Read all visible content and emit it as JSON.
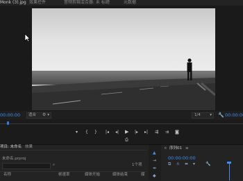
{
  "app": {
    "tabs": [
      {
        "label": "Monk (3).jpg",
        "active": true
      },
      {
        "label": "效果控件",
        "active": false
      },
      {
        "label": "音频剪辑混合器: 未 标题",
        "active": false
      },
      {
        "label": "元数据",
        "active": false
      }
    ]
  },
  "program_monitor": {
    "timecode_left": "00:00:00",
    "fit_label": "适合",
    "quality_label": "1/4",
    "timecode_right": "00:00:00",
    "controls": [
      "marker-icon",
      "mark-in-icon",
      "mark-out-icon",
      "go-to-in-icon",
      "step-back-icon",
      "play-icon",
      "step-forward-icon",
      "go-to-out-icon",
      "insert-icon",
      "overwrite-icon",
      "export-frame-icon",
      "settings-icon"
    ]
  },
  "project_panel": {
    "title": "项目: 未命名",
    "tab2": "效果",
    "filename": "未命名.prproj",
    "search_placeholder": "",
    "item_count": "1个项",
    "columns": [
      "名称",
      "帧速率",
      "媒体开始",
      "媒体结束",
      "媒"
    ]
  },
  "timeline_panel": {
    "title": "序列01",
    "timecode": "00:00:00:00"
  },
  "colors": {
    "accent": "#3d8ff0",
    "panel_bg": "#232323",
    "dark_bg": "#1a1a1a"
  }
}
